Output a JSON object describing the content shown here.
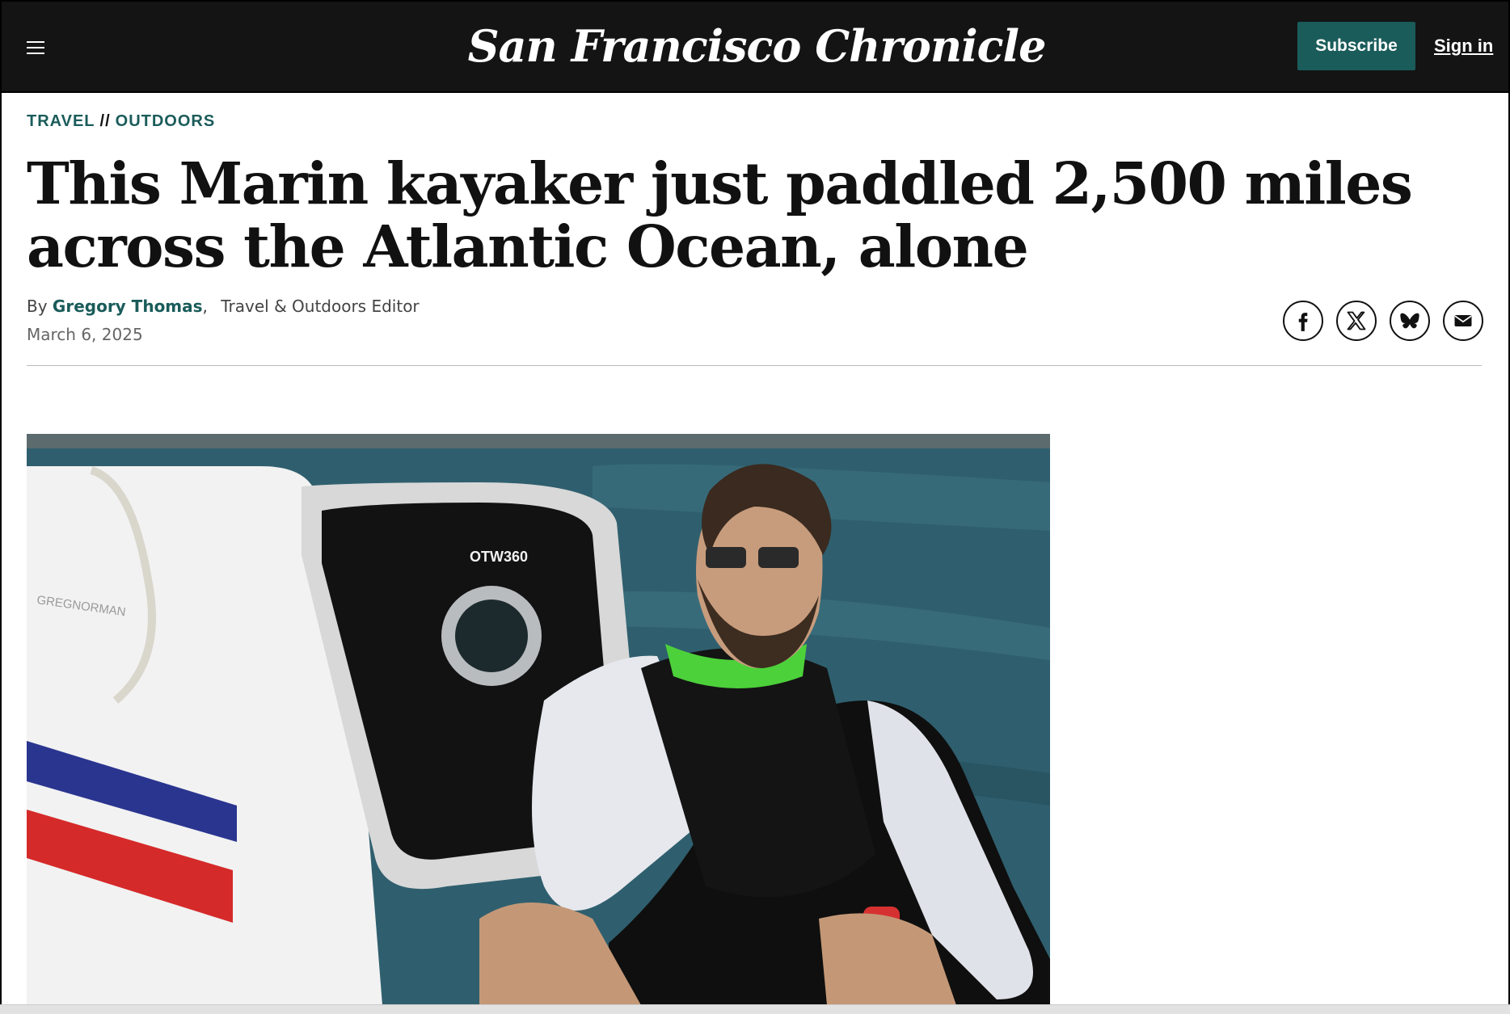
{
  "header": {
    "logo": "San Francisco Chronicle",
    "menu_icon": "hamburger-menu-icon",
    "subscribe_label": "Subscribe",
    "signin_label": "Sign in"
  },
  "article": {
    "section": "TRAVEL",
    "separator": "//",
    "subsection": "OUTDOORS",
    "headline": "This Marin kayaker just paddled 2,500 miles across the Atlantic Ocean, alone",
    "byline_prefix": "By",
    "author": "Gregory Thomas",
    "author_sep": ",",
    "author_role": "Travel & Outdoors Editor",
    "date": "March 6, 2025"
  },
  "share": [
    {
      "icon": "facebook-icon"
    },
    {
      "icon": "x-icon"
    },
    {
      "icon": "bluesky-icon"
    },
    {
      "icon": "email-icon"
    }
  ],
  "photo": {
    "boat_label": "OTW360",
    "boat_brand": "GREGNORMAN"
  },
  "colors": {
    "header_bg": "#141414",
    "brand_teal": "#1a5c5a",
    "water": "#2f5f6e"
  }
}
